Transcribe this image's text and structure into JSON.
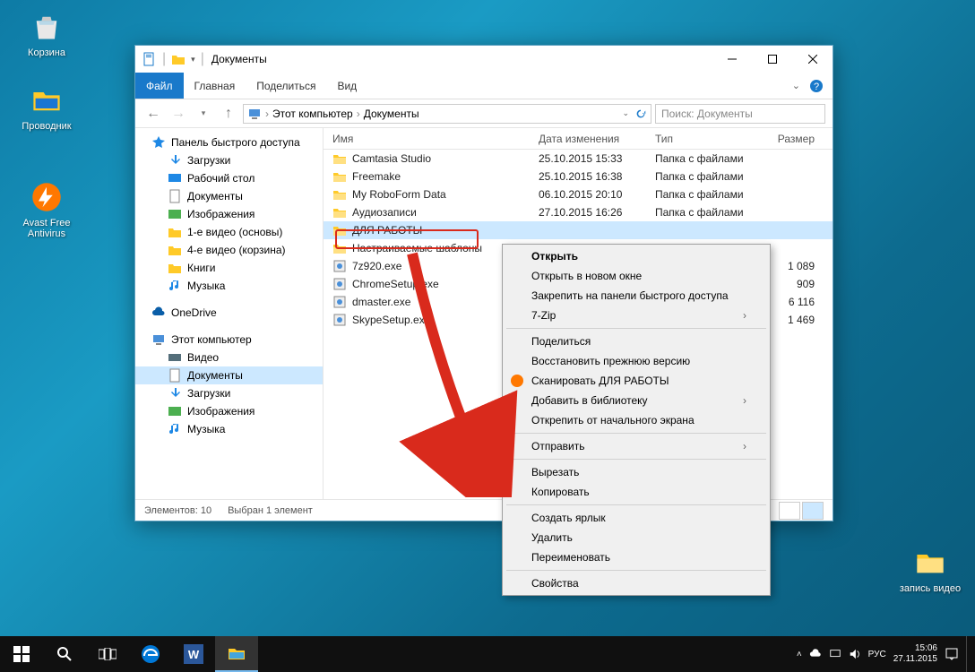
{
  "desktop": {
    "icons": [
      {
        "id": "recycle-bin",
        "label": "Корзина"
      },
      {
        "id": "explorer",
        "label": "Проводник"
      },
      {
        "id": "avast",
        "label": "Avast Free Antivirus"
      },
      {
        "id": "record-video",
        "label": "запись видео"
      }
    ]
  },
  "window": {
    "title": "Документы",
    "ribbon": {
      "file": "Файл",
      "tabs": [
        "Главная",
        "Поделиться",
        "Вид"
      ]
    },
    "breadcrumb": [
      "Этот компьютер",
      "Документы"
    ],
    "search_placeholder": "Поиск: Документы",
    "columns": {
      "name": "Имя",
      "date": "Дата изменения",
      "type": "Тип",
      "size": "Размер"
    },
    "rows": [
      {
        "icon": "folder",
        "name": "Camtasia Studio",
        "date": "25.10.2015 15:33",
        "type": "Папка с файлами",
        "size": ""
      },
      {
        "icon": "folder",
        "name": "Freemake",
        "date": "25.10.2015 16:38",
        "type": "Папка с файлами",
        "size": ""
      },
      {
        "icon": "folder",
        "name": "My RoboForm Data",
        "date": "06.10.2015 20:10",
        "type": "Папка с файлами",
        "size": ""
      },
      {
        "icon": "folder",
        "name": "Аудиозаписи",
        "date": "27.10.2015 16:26",
        "type": "Папка с файлами",
        "size": ""
      },
      {
        "icon": "folder",
        "name": "ДЛЯ РАБОТЫ",
        "date": "",
        "type": "",
        "size": "",
        "selected": true
      },
      {
        "icon": "folder",
        "name": "Настраиваемые шаблоны",
        "date": "",
        "type": "",
        "size": ""
      },
      {
        "icon": "exe",
        "name": "7z920.exe",
        "date": "",
        "type": "",
        "size": "1 089"
      },
      {
        "icon": "exe",
        "name": "ChromeSetup.exe",
        "date": "",
        "type": "",
        "size": "909"
      },
      {
        "icon": "exe",
        "name": "dmaster.exe",
        "date": "",
        "type": "",
        "size": "6 116"
      },
      {
        "icon": "exe",
        "name": "SkypeSetup.exe",
        "date": "",
        "type": "",
        "size": "1 469"
      }
    ],
    "sidebar": {
      "quick": {
        "label": "Панель быстрого доступа",
        "items": [
          "Загрузки",
          "Рабочий стол",
          "Документы",
          "Изображения",
          "1-е видео (основы)",
          "4-е видео (корзина)",
          "Книги",
          "Музыка"
        ]
      },
      "onedrive": "OneDrive",
      "thispc": {
        "label": "Этот компьютер",
        "items": [
          "Видео",
          "Документы",
          "Загрузки",
          "Изображения",
          "Музыка"
        ],
        "selected": "Документы"
      }
    },
    "status": {
      "count": "Элементов: 10",
      "selected": "Выбран 1 элемент"
    }
  },
  "context_menu": {
    "items": [
      {
        "label": "Открыть",
        "bold": true
      },
      {
        "label": "Открыть в новом окне"
      },
      {
        "label": "Закрепить на панели быстрого доступа"
      },
      {
        "label": "7-Zip",
        "submenu": true
      },
      {
        "sep": true
      },
      {
        "label": "Поделиться"
      },
      {
        "label": "Восстановить прежнюю версию"
      },
      {
        "label": "Сканировать ДЛЯ РАБОТЫ",
        "icon": "avast"
      },
      {
        "label": "Добавить в библиотеку",
        "submenu": true
      },
      {
        "label": "Открепить от начального экрана"
      },
      {
        "sep": true
      },
      {
        "label": "Отправить",
        "submenu": true
      },
      {
        "sep": true
      },
      {
        "label": "Вырезать"
      },
      {
        "label": "Копировать"
      },
      {
        "sep": true
      },
      {
        "label": "Создать ярлык"
      },
      {
        "label": "Удалить"
      },
      {
        "label": "Переименовать"
      },
      {
        "sep": true
      },
      {
        "label": "Свойства"
      }
    ]
  },
  "taskbar": {
    "lang": "РУС",
    "time": "15:06",
    "date": "27.11.2015"
  }
}
